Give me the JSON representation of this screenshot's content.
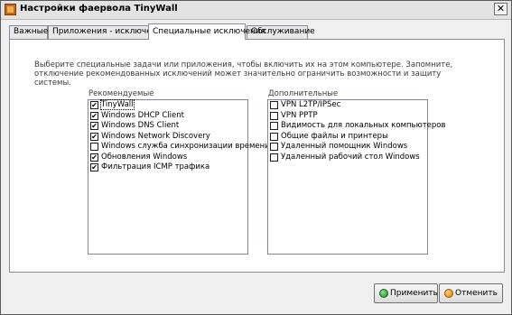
{
  "window": {
    "title": "Настройки фаервола TinyWall",
    "close_glyph": "✕"
  },
  "tabs": [
    {
      "label": "Важные"
    },
    {
      "label": "Приложения - исключения"
    },
    {
      "label": "Специальные исключения",
      "active": true
    },
    {
      "label": "Обслуживание"
    }
  ],
  "description": "Выберите специальные задачи или приложения, чтобы включить их на этом компьютере. Запомните, отключение рекомендованных исключений может значительно ограничить возможности и защиту системы.",
  "recommended": {
    "label": "Рекомендуемые",
    "items": [
      {
        "text": "TinyWall",
        "checked": true,
        "selected": true
      },
      {
        "text": "Windows DHCP Client",
        "checked": true
      },
      {
        "text": "Windows DNS Client",
        "checked": true
      },
      {
        "text": "Windows Network Discovery",
        "checked": true
      },
      {
        "text": "Windows служба синхронизации времени",
        "checked": false
      },
      {
        "text": "Обновления Windows",
        "checked": true
      },
      {
        "text": "Фильтрация ICMP трафика",
        "checked": true
      }
    ]
  },
  "additional": {
    "label": "Дополнительные",
    "items": [
      {
        "text": "VPN L2TP/IPSec",
        "checked": false
      },
      {
        "text": "VPN PPTP",
        "checked": false
      },
      {
        "text": "Видимость для локальных компьютеров",
        "checked": false
      },
      {
        "text": "Общие файлы и принтеры",
        "checked": false
      },
      {
        "text": "Удаленный помощник Windows",
        "checked": false
      },
      {
        "text": "Удаленный рабочий стол Windows",
        "checked": false
      }
    ]
  },
  "buttons": {
    "apply": "Применить",
    "cancel": "Отменить"
  },
  "check_glyph": "✔"
}
